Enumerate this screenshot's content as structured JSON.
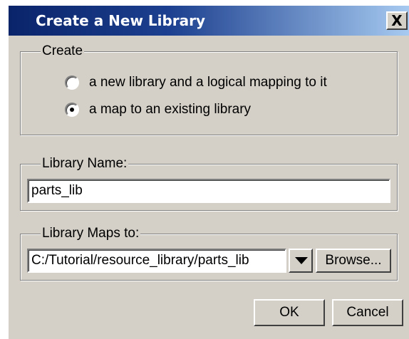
{
  "dialog": {
    "title": "Create a New Library",
    "close_label": "X"
  },
  "create_group": {
    "legend": "Create",
    "options": [
      {
        "label": "a new library and a logical mapping to it",
        "selected": false
      },
      {
        "label": "a map to an existing library",
        "selected": true
      }
    ]
  },
  "library_name": {
    "legend": "Library Name:",
    "value": "parts_lib"
  },
  "library_maps": {
    "legend": "Library Maps to:",
    "value": "C:/Tutorial/resource_library/parts_lib",
    "dropdown_icon": "chevron-down-icon",
    "browse_label": "Browse..."
  },
  "buttons": {
    "ok_label": "OK",
    "cancel_label": "Cancel"
  }
}
